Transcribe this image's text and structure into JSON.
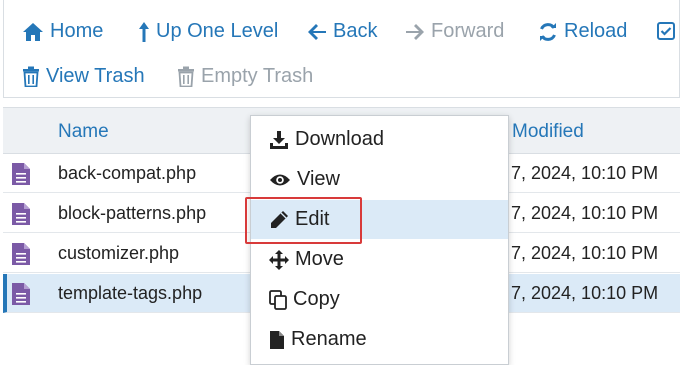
{
  "toolbar": {
    "home": "Home",
    "up_one_level": "Up One Level",
    "back": "Back",
    "forward": "Forward",
    "reload": "Reload",
    "view_trash": "View Trash",
    "empty_trash": "Empty Trash"
  },
  "table": {
    "columns": {
      "name": "Name",
      "modified": "Modified"
    },
    "rows": [
      {
        "name": "back-compat.php",
        "modified": "7, 2024, 10:10 PM"
      },
      {
        "name": "block-patterns.php",
        "modified": "7, 2024, 10:10 PM"
      },
      {
        "name": "customizer.php",
        "modified": "7, 2024, 10:10 PM"
      },
      {
        "name": "template-tags.php",
        "modified": "7, 2024, 10:10 PM"
      }
    ],
    "selected_row": 3
  },
  "context_menu": {
    "items": [
      "Download",
      "View",
      "Edit",
      "Move",
      "Copy",
      "Rename"
    ],
    "active_item": "Edit"
  },
  "colors": {
    "accent": "#2577b8",
    "selected_bg": "#dbeaf7",
    "file_icon": "#7b5aa6",
    "highlight": "#d83a3a"
  }
}
